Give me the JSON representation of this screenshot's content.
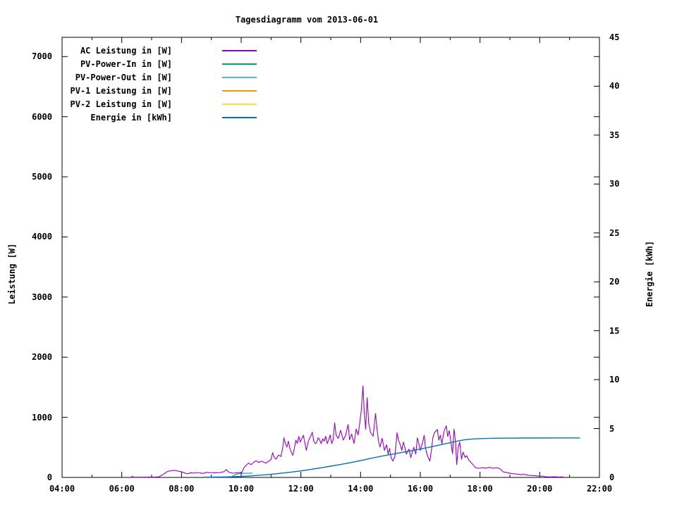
{
  "title": "Tagesdiagramm vom 2013-06-01",
  "chart_data": {
    "type": "line",
    "title": "Tagesdiagramm vom 2013-06-01",
    "background": "#ffffff",
    "border_color": "#000000",
    "x_axis": {
      "range_hours": [
        4,
        22
      ],
      "major_ticks": [
        {
          "hour": 4,
          "label": "04:00"
        },
        {
          "hour": 6,
          "label": "06:00"
        },
        {
          "hour": 8,
          "label": "08:00"
        },
        {
          "hour": 10,
          "label": "10:00"
        },
        {
          "hour": 12,
          "label": "12:00"
        },
        {
          "hour": 14,
          "label": "14:00"
        },
        {
          "hour": 16,
          "label": "16:00"
        },
        {
          "hour": 18,
          "label": "18:00"
        },
        {
          "hour": 20,
          "label": "20:00"
        },
        {
          "hour": 22,
          "label": "22:00"
        }
      ],
      "minor_tick_hours": [
        5,
        7,
        9,
        11,
        13,
        15,
        17,
        19,
        21
      ]
    },
    "y_left": {
      "label": "Leistung [W]",
      "range": [
        0,
        7320
      ],
      "ticks": [
        0,
        1000,
        2000,
        3000,
        4000,
        5000,
        6000,
        7000
      ],
      "tick_labels": [
        "0",
        "1000",
        "2000",
        "3000",
        "4000",
        "5000",
        "6000",
        "7000"
      ]
    },
    "y_right": {
      "label": "Energie [kWh]",
      "range": [
        0,
        45
      ],
      "ticks": [
        0,
        5,
        10,
        15,
        20,
        25,
        30,
        35,
        40,
        45
      ],
      "tick_labels": [
        "0",
        "5",
        "10",
        "15",
        "20",
        "25",
        "30",
        "35",
        "40",
        "45"
      ]
    },
    "legend": [
      {
        "label": "AC Leistung in [W]",
        "color": "#9400d3"
      },
      {
        "label": "PV-Power-In in [W]",
        "color": "#009e73"
      },
      {
        "label": "PV-Power-Out in [W]",
        "color": "#56b4e9"
      },
      {
        "label": "PV-1 Leistung in [W]",
        "color": "#e69f00"
      },
      {
        "label": "PV-2 Leistung in [W]",
        "color": "#f0e442"
      },
      {
        "label": "Energie in [kWh]",
        "color": "#0072b2"
      }
    ],
    "legend_position": "top-left-inside",
    "grid": false,
    "series": [
      {
        "name": "AC Leistung in [W]",
        "axis": "left",
        "color": "#9400d3",
        "unit": "W",
        "points": [
          [
            6.32,
            0
          ],
          [
            6.35,
            20
          ],
          [
            6.38,
            3
          ],
          [
            6.5,
            4
          ],
          [
            6.7,
            4
          ],
          [
            6.9,
            5
          ],
          [
            7.1,
            6
          ],
          [
            7.25,
            10
          ],
          [
            7.3,
            25
          ],
          [
            7.4,
            55
          ],
          [
            7.5,
            90
          ],
          [
            7.58,
            105
          ],
          [
            7.67,
            112
          ],
          [
            7.75,
            118
          ],
          [
            7.83,
            112
          ],
          [
            7.92,
            102
          ],
          [
            8.0,
            95
          ],
          [
            8.08,
            80
          ],
          [
            8.17,
            62
          ],
          [
            8.25,
            68
          ],
          [
            8.33,
            78
          ],
          [
            8.42,
            70
          ],
          [
            8.5,
            82
          ],
          [
            8.58,
            76
          ],
          [
            8.67,
            72
          ],
          [
            8.75,
            68
          ],
          [
            8.83,
            86
          ],
          [
            8.92,
            76
          ],
          [
            9.0,
            82
          ],
          [
            9.08,
            74
          ],
          [
            9.17,
            80
          ],
          [
            9.25,
            76
          ],
          [
            9.33,
            86
          ],
          [
            9.42,
            95
          ],
          [
            9.5,
            130
          ],
          [
            9.55,
            100
          ],
          [
            9.63,
            78
          ],
          [
            9.72,
            70
          ],
          [
            9.8,
            74
          ],
          [
            9.88,
            78
          ],
          [
            9.97,
            82
          ],
          [
            10.0,
            60
          ],
          [
            10.05,
            115
          ],
          [
            10.1,
            168
          ],
          [
            10.17,
            205
          ],
          [
            10.25,
            238
          ],
          [
            10.33,
            212
          ],
          [
            10.42,
            252
          ],
          [
            10.5,
            278
          ],
          [
            10.58,
            248
          ],
          [
            10.67,
            268
          ],
          [
            10.75,
            256
          ],
          [
            10.83,
            238
          ],
          [
            10.92,
            272
          ],
          [
            11.0,
            298
          ],
          [
            11.05,
            412
          ],
          [
            11.1,
            335
          ],
          [
            11.17,
            305
          ],
          [
            11.25,
            372
          ],
          [
            11.33,
            348
          ],
          [
            11.4,
            520
          ],
          [
            11.43,
            658
          ],
          [
            11.48,
            565
          ],
          [
            11.53,
            505
          ],
          [
            11.58,
            602
          ],
          [
            11.63,
            485
          ],
          [
            11.68,
            415
          ],
          [
            11.73,
            368
          ],
          [
            11.78,
            482
          ],
          [
            11.83,
            622
          ],
          [
            11.88,
            565
          ],
          [
            11.93,
            682
          ],
          [
            11.98,
            588
          ],
          [
            12.03,
            648
          ],
          [
            12.08,
            702
          ],
          [
            12.13,
            582
          ],
          [
            12.18,
            452
          ],
          [
            12.23,
            562
          ],
          [
            12.28,
            642
          ],
          [
            12.33,
            685
          ],
          [
            12.38,
            752
          ],
          [
            12.43,
            602
          ],
          [
            12.48,
            562
          ],
          [
            12.53,
            585
          ],
          [
            12.58,
            662
          ],
          [
            12.63,
            622
          ],
          [
            12.68,
            562
          ],
          [
            12.73,
            642
          ],
          [
            12.78,
            602
          ],
          [
            12.83,
            685
          ],
          [
            12.88,
            562
          ],
          [
            12.93,
            622
          ],
          [
            12.98,
            705
          ],
          [
            13.03,
            562
          ],
          [
            13.08,
            625
          ],
          [
            13.13,
            905
          ],
          [
            13.18,
            702
          ],
          [
            13.25,
            648
          ],
          [
            13.33,
            782
          ],
          [
            13.42,
            622
          ],
          [
            13.5,
            705
          ],
          [
            13.58,
            882
          ],
          [
            13.63,
            625
          ],
          [
            13.7,
            722
          ],
          [
            13.78,
            565
          ],
          [
            13.85,
            805
          ],
          [
            13.92,
            705
          ],
          [
            13.97,
            905
          ],
          [
            14.02,
            1105
          ],
          [
            14.08,
            1522
          ],
          [
            14.12,
            1105
          ],
          [
            14.17,
            805
          ],
          [
            14.22,
            1325
          ],
          [
            14.27,
            905
          ],
          [
            14.33,
            752
          ],
          [
            14.42,
            685
          ],
          [
            14.5,
            1062
          ],
          [
            14.55,
            805
          ],
          [
            14.6,
            605
          ],
          [
            14.65,
            505
          ],
          [
            14.72,
            652
          ],
          [
            14.8,
            448
          ],
          [
            14.87,
            542
          ],
          [
            14.92,
            388
          ],
          [
            14.97,
            482
          ],
          [
            15.02,
            332
          ],
          [
            15.08,
            272
          ],
          [
            15.15,
            352
          ],
          [
            15.22,
            742
          ],
          [
            15.27,
            622
          ],
          [
            15.33,
            542
          ],
          [
            15.38,
            448
          ],
          [
            15.43,
            588
          ],
          [
            15.48,
            502
          ],
          [
            15.53,
            388
          ],
          [
            15.62,
            472
          ],
          [
            15.68,
            332
          ],
          [
            15.73,
            422
          ],
          [
            15.78,
            502
          ],
          [
            15.85,
            388
          ],
          [
            15.9,
            658
          ],
          [
            15.95,
            562
          ],
          [
            16.0,
            448
          ],
          [
            16.08,
            588
          ],
          [
            16.13,
            702
          ],
          [
            16.17,
            502
          ],
          [
            16.22,
            388
          ],
          [
            16.32,
            272
          ],
          [
            16.37,
            448
          ],
          [
            16.42,
            658
          ],
          [
            16.47,
            742
          ],
          [
            16.57,
            798
          ],
          [
            16.62,
            622
          ],
          [
            16.67,
            702
          ],
          [
            16.72,
            562
          ],
          [
            16.8,
            778
          ],
          [
            16.87,
            858
          ],
          [
            16.92,
            682
          ],
          [
            16.97,
            778
          ],
          [
            17.03,
            562
          ],
          [
            17.08,
            392
          ],
          [
            17.13,
            805
          ],
          [
            17.18,
            585
          ],
          [
            17.22,
            212
          ],
          [
            17.27,
            502
          ],
          [
            17.32,
            588
          ],
          [
            17.38,
            302
          ],
          [
            17.43,
            422
          ],
          [
            17.5,
            332
          ],
          [
            17.55,
            362
          ],
          [
            17.63,
            282
          ],
          [
            17.73,
            232
          ],
          [
            17.85,
            162
          ],
          [
            17.97,
            152
          ],
          [
            18.08,
            162
          ],
          [
            18.2,
            155
          ],
          [
            18.32,
            168
          ],
          [
            18.43,
            152
          ],
          [
            18.55,
            162
          ],
          [
            18.67,
            145
          ],
          [
            18.77,
            92
          ],
          [
            18.92,
            78
          ],
          [
            19.05,
            66
          ],
          [
            19.15,
            60
          ],
          [
            19.25,
            55
          ],
          [
            19.38,
            46
          ],
          [
            19.47,
            52
          ],
          [
            19.62,
            36
          ],
          [
            19.85,
            28
          ],
          [
            20.0,
            20
          ],
          [
            20.08,
            24
          ],
          [
            20.2,
            12
          ],
          [
            20.35,
            8
          ],
          [
            20.5,
            11
          ],
          [
            20.65,
            7
          ],
          [
            20.78,
            9
          ]
        ]
      },
      {
        "name": "PV-Power-In in [W]",
        "axis": "left",
        "color": "#009e73",
        "unit": "W",
        "points": [
          [
            9.7,
            15
          ],
          [
            9.8,
            45
          ],
          [
            9.9,
            62
          ],
          [
            10.05,
            68
          ],
          [
            10.2,
            70
          ],
          [
            10.38,
            72
          ]
        ]
      },
      {
        "name": "PV-Power-Out in [W]",
        "axis": "left",
        "color": "#56b4e9",
        "unit": "W",
        "points": []
      },
      {
        "name": "PV-1 Leistung in [W]",
        "axis": "left",
        "color": "#e69f00",
        "unit": "W",
        "points": []
      },
      {
        "name": "PV-2 Leistung in [W]",
        "axis": "left",
        "color": "#f0e442",
        "unit": "W",
        "points": []
      },
      {
        "name": "Energie in [kWh]",
        "axis": "right",
        "color": "#0072b2",
        "unit": "kWh",
        "points": [
          [
            8.75,
            0.02
          ],
          [
            9.0,
            0.03
          ],
          [
            9.5,
            0.05
          ],
          [
            10.0,
            0.1
          ],
          [
            10.25,
            0.14
          ],
          [
            10.5,
            0.2
          ],
          [
            10.75,
            0.26
          ],
          [
            11.0,
            0.32
          ],
          [
            11.25,
            0.4
          ],
          [
            11.5,
            0.48
          ],
          [
            11.75,
            0.57
          ],
          [
            12.0,
            0.67
          ],
          [
            12.25,
            0.78
          ],
          [
            12.5,
            0.9
          ],
          [
            12.75,
            1.02
          ],
          [
            13.0,
            1.15
          ],
          [
            13.25,
            1.28
          ],
          [
            13.5,
            1.42
          ],
          [
            13.75,
            1.57
          ],
          [
            14.0,
            1.72
          ],
          [
            14.25,
            1.89
          ],
          [
            14.5,
            2.05
          ],
          [
            14.75,
            2.2
          ],
          [
            15.0,
            2.35
          ],
          [
            15.25,
            2.48
          ],
          [
            15.5,
            2.62
          ],
          [
            15.75,
            2.76
          ],
          [
            16.0,
            2.9
          ],
          [
            16.25,
            3.06
          ],
          [
            16.5,
            3.22
          ],
          [
            16.75,
            3.39
          ],
          [
            17.0,
            3.55
          ],
          [
            17.25,
            3.72
          ],
          [
            17.5,
            3.86
          ],
          [
            17.75,
            3.93
          ],
          [
            18.0,
            3.97
          ],
          [
            18.25,
            3.99
          ],
          [
            18.5,
            4.01
          ],
          [
            19.0,
            4.02
          ],
          [
            19.5,
            4.03
          ],
          [
            20.0,
            4.03
          ],
          [
            20.5,
            4.04
          ],
          [
            21.0,
            4.04
          ],
          [
            21.35,
            4.04
          ]
        ]
      }
    ]
  }
}
